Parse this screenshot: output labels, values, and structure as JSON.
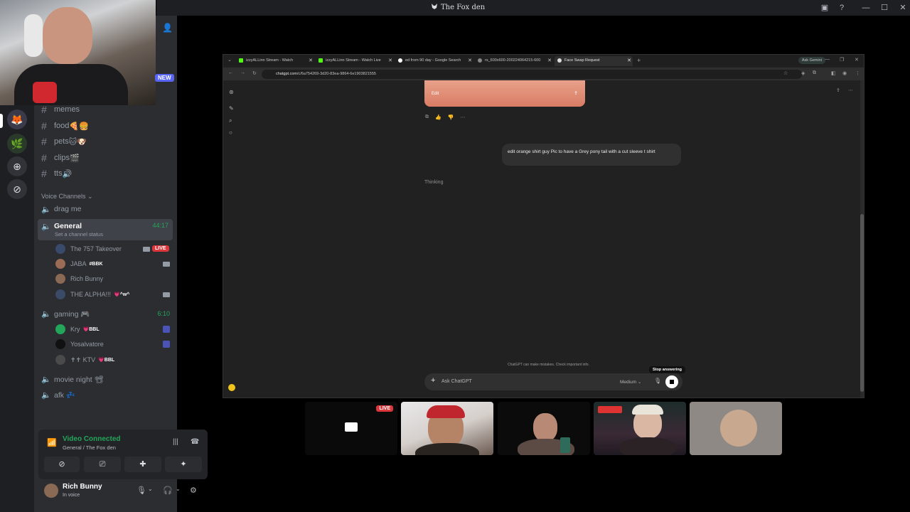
{
  "titlebar": {
    "title": "The Fox den"
  },
  "webcam": {
    "badge": "NEW"
  },
  "channels": {
    "text": [
      {
        "name": "memes",
        "emoji": ""
      },
      {
        "name": "food",
        "emoji": "🍕🍔"
      },
      {
        "name": "pets",
        "emoji": "🐱🐶"
      },
      {
        "name": "clips",
        "emoji": "🎬"
      },
      {
        "name": "tts",
        "emoji": "🔊"
      }
    ],
    "voice_category": "Voice Channels",
    "voice": {
      "drag_me": "drag me",
      "general": {
        "name": "General",
        "timer": "44:17",
        "status": "Set a channel status"
      },
      "general_users": [
        {
          "name": "The 757 Takeover",
          "tag": "",
          "live": "LIVE"
        },
        {
          "name": "JABA",
          "tag": "#BBK"
        },
        {
          "name": "Rich Bunny",
          "tag": ""
        },
        {
          "name": "THE ALPHA!!!",
          "tag": "💗^w^"
        }
      ],
      "gaming": {
        "name": "gaming 🎮",
        "timer": "6:10"
      },
      "gaming_users": [
        {
          "name": "Kry",
          "tag": "💗BBL"
        },
        {
          "name": "Yosalvatore",
          "tag": ""
        },
        {
          "name": "✝✝ KTV",
          "tag": "💗BBL"
        }
      ],
      "movie_night": "movie night 📽",
      "afk": "afk 💤"
    }
  },
  "voice_panel": {
    "status": "Video Connected",
    "sub": "General / The Fox den"
  },
  "user_panel": {
    "name": "Rich Bunny",
    "status": "In voice"
  },
  "browser": {
    "tabs": [
      {
        "title": "izzyALLinn Stream - Watch"
      },
      {
        "title": "izzyALLinn Stream - Watch Live"
      },
      {
        "title": "ed from 90 day - Google Search"
      },
      {
        "title": "rs_600x600-200224064215-600"
      },
      {
        "title": "Face Swap Request"
      }
    ],
    "gemini": "Ask Gemini",
    "url_host": "chatgpt.com",
    "url_path": "/c/6a754269-3d20-83ea-9864-6e1903821555"
  },
  "chat": {
    "edit_label": "Edit",
    "user_message": "edit orange shirt guy Pic to have a Grey pony tail with a cut sleeve t shirt",
    "thinking": "Thinking",
    "disclaimer": "ChatGPT can make mistakes. Check important info.",
    "stop_tooltip": "Stop answering",
    "placeholder": "Ask ChatGPT",
    "model": "Medium"
  },
  "stream_tiles": {
    "live": "LIVE"
  }
}
